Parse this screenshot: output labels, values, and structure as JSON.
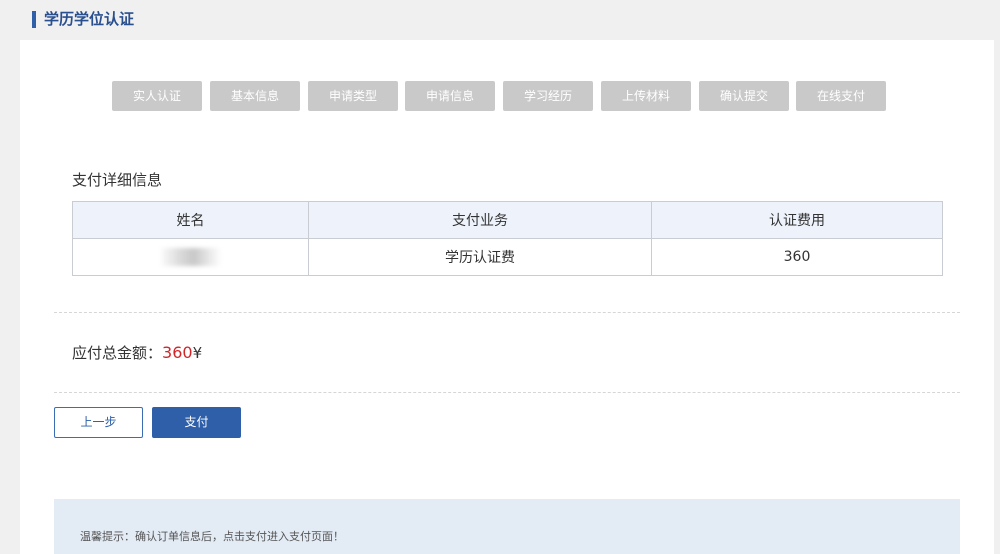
{
  "header": {
    "title": "学历学位认证"
  },
  "steps": [
    {
      "label": "实人认证"
    },
    {
      "label": "基本信息"
    },
    {
      "label": "申请类型"
    },
    {
      "label": "申请信息"
    },
    {
      "label": "学习经历"
    },
    {
      "label": "上传材料"
    },
    {
      "label": "确认提交"
    },
    {
      "label": "在线支付"
    }
  ],
  "payment": {
    "section_title": "支付详细信息",
    "columns": [
      "姓名",
      "支付业务",
      "认证费用"
    ],
    "row": {
      "name": "",
      "business": "学历认证费",
      "fee": "360"
    }
  },
  "total": {
    "label": "应付总金额：",
    "amount": "360",
    "currency": "¥"
  },
  "buttons": {
    "prev_label": "上一步",
    "pay_label": "支付"
  },
  "tip": {
    "text": "温馨提示：确认订单信息后，点击支付进入支付页面！"
  },
  "colors": {
    "primary": "#2e5fa8",
    "amount": "#d0262a",
    "step_bg": "#c9c9c9",
    "tip_bg": "#e3ebf5"
  }
}
